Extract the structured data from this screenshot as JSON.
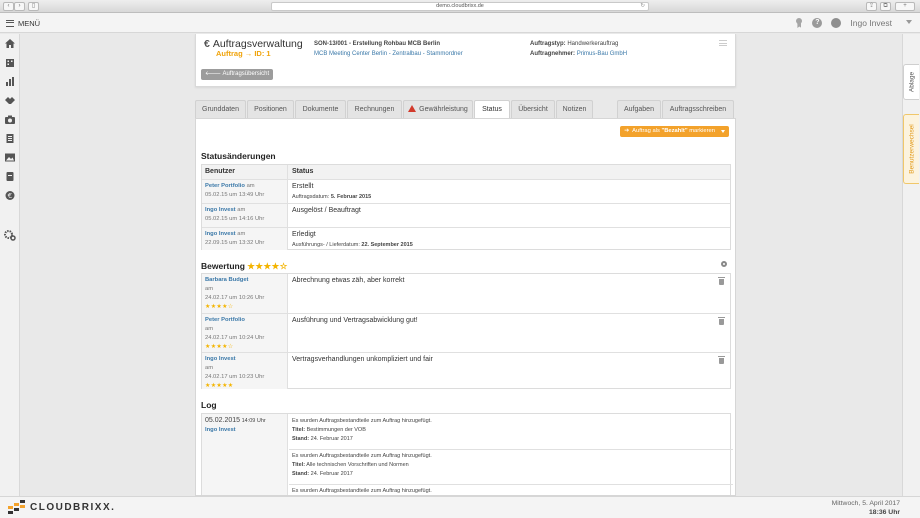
{
  "browser": {
    "url": "demo.cloudbrixx.de",
    "reload_icon": "reload-icon"
  },
  "appbar": {
    "menu_label": "MENÜ",
    "username": "Ingo Invest",
    "help_icon": "?"
  },
  "right_tabs": {
    "ablage": "Ablage",
    "benutzerwechsel": "Benutzerwechsel"
  },
  "header": {
    "title": "Auftragsverwaltung",
    "euro": "€",
    "subtitle": "Auftrag → ID: 1",
    "project": "SON-13/001 - Erstellung Rohbau MCB Berlin",
    "location": "MCB Meeting Center Berlin - Zentralbau - Stammordner",
    "type_label": "Auftragstyp:",
    "type_value": "Handwerkerauftrag",
    "contractor_label": "Auftragnehmer:",
    "contractor_value": "Primus-Bau GmbH",
    "back_button": "Auftragsübersicht"
  },
  "tabs": [
    {
      "label": "Grunddaten"
    },
    {
      "label": "Positionen"
    },
    {
      "label": "Dokumente"
    },
    {
      "label": "Rechnungen"
    },
    {
      "label": "Gewährleistung"
    },
    {
      "label": "Status"
    },
    {
      "label": "Übersicht"
    },
    {
      "label": "Notizen"
    },
    {
      "label": "Aufgaben"
    },
    {
      "label": "Auftragsschreiben"
    }
  ],
  "status_button": {
    "prefix": "Auftrag als ",
    "highlight": "\"Bezahlt\"",
    "suffix": " markieren"
  },
  "statusaenderungen": {
    "title": "Statusänderungen",
    "col_user": "Benutzer",
    "col_status": "Status",
    "rows": [
      {
        "user": "Peter Portfolio",
        "am": " am",
        "date": "05.02.15 um 13:49 Uhr",
        "status": "Erstellt",
        "detail_label": "Auftragsdatum: ",
        "detail_value": "5. Februar 2015"
      },
      {
        "user": "Ingo Invest",
        "am": " am",
        "date": "05.02.15 um 14:16 Uhr",
        "status": "Ausgelöst / Beauftragt",
        "detail_label": "",
        "detail_value": ""
      },
      {
        "user": "Ingo Invest",
        "am": " am",
        "date": "22.09.15 um 13:32 Uhr",
        "status": "Erledigt",
        "detail_label": "Ausführungs- / Lieferdatum: ",
        "detail_value": "22. September 2015"
      }
    ]
  },
  "bewertung": {
    "title": "Bewertung",
    "stars": "★★★★☆",
    "rows": [
      {
        "user": "Barbara Budget",
        "am": "am",
        "date": "24.02.17 um 10:26 Uhr",
        "stars": "★★★★☆",
        "text": "Abrechnung etwas zäh, aber korrekt"
      },
      {
        "user": "Peter Portfolio",
        "am": "am",
        "date": "24.02.17 um 10:24 Uhr",
        "stars": "★★★★☆",
        "text": "Ausführung und Vertragsabwicklung gut!"
      },
      {
        "user": "Ingo Invest",
        "am": "am",
        "date": "24.02.17 um 10:23 Uhr",
        "stars": "★★★★★",
        "text": "Vertragsverhandlungen unkompliziert und fair"
      }
    ]
  },
  "log": {
    "title": "Log",
    "date": "05.02.2015",
    "time": " 14:09 Uhr",
    "user": "Ingo Invest",
    "entries": [
      {
        "text": "Es wurden Auftragsbestandteile zum Auftrag hinzugefügt.",
        "titel_label": "Titel:",
        "titel": " Bestimmungen der VOB",
        "stand_label": "Stand:",
        "stand": " 24. Februar 2017"
      },
      {
        "text": "Es wurden Auftragsbestandteile zum Auftrag hinzugefügt.",
        "titel_label": "Titel:",
        "titel": " Alle technischen Vorschriften und Normen",
        "stand_label": "Stand:",
        "stand": " 24. Februar 2017"
      },
      {
        "text": "Es wurden Auftragsbestandteile zum Auftrag hinzugefügt.",
        "titel_label": "",
        "titel": "",
        "stand_label": "",
        "stand": ""
      }
    ]
  },
  "footer": {
    "logo": "CLOUDBRIXX.",
    "date": "Mittwoch, 5. April 2017",
    "time": "18:36 Uhr"
  }
}
